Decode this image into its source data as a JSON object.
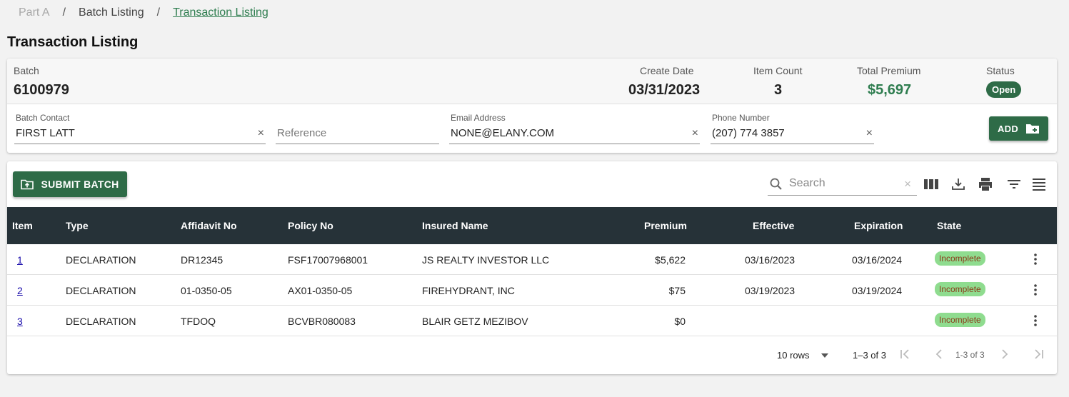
{
  "breadcrumb": {
    "part": "Part A",
    "sep": "/",
    "batch_listing": "Batch Listing",
    "current": "Transaction Listing"
  },
  "page_title": "Transaction Listing",
  "batch": {
    "batch_label": "Batch",
    "batch_value": "6100979",
    "create_date_label": "Create Date",
    "create_date_value": "03/31/2023",
    "item_count_label": "Item Count",
    "item_count_value": "3",
    "total_premium_label": "Total Premium",
    "total_premium_value": "$5,697",
    "status_label": "Status",
    "status_value": "Open"
  },
  "fields": {
    "contact_label": "Batch Contact",
    "contact_value": "FIRST LATT",
    "reference_placeholder": "Reference",
    "email_label": "Email Address",
    "email_value": "NONE@ELANY.COM",
    "phone_label": "Phone Number",
    "phone_value": "(207) 774 3857",
    "clear": "×"
  },
  "add_button": "ADD",
  "submit_button": "SUBMIT BATCH",
  "search": {
    "placeholder": "Search",
    "clear": "×"
  },
  "table": {
    "headers": {
      "item": "Item",
      "type": "Type",
      "affidavit": "Affidavit No",
      "policy": "Policy No",
      "insured": "Insured Name",
      "premium": "Premium",
      "effective": "Effective",
      "expiration": "Expiration",
      "state": "State"
    },
    "rows": [
      {
        "item": "1",
        "type": "DECLARATION",
        "affidavit": "DR12345",
        "policy": "FSF17007968001",
        "insured": "JS REALTY INVESTOR LLC",
        "premium": "$5,622",
        "effective": "03/16/2023",
        "expiration": "03/16/2024",
        "state": "Incomplete"
      },
      {
        "item": "2",
        "type": "DECLARATION",
        "affidavit": "01-0350-05",
        "policy": "AX01-0350-05",
        "insured": "FIREHYDRANT, INC",
        "premium": "$75",
        "effective": "03/19/2023",
        "expiration": "03/19/2024",
        "state": "Incomplete"
      },
      {
        "item": "3",
        "type": "DECLARATION",
        "affidavit": "TFDOQ",
        "policy": "BCVBR080083",
        "insured": "BLAIR GETZ MEZIBOV",
        "premium": "$0",
        "effective": "",
        "expiration": "",
        "state": "Incomplete"
      }
    ]
  },
  "pagination": {
    "rows_per_page": "10 rows",
    "range": "1–3 of 3",
    "range_mid": "1-3 of 3"
  },
  "icons": {
    "columns": "view-column-icon",
    "download": "download-icon",
    "print": "print-icon",
    "filter": "filter-icon",
    "density": "density-icon",
    "search": "search-icon",
    "upload": "upload-folder-icon",
    "add_folder": "add-folder-icon"
  },
  "colors": {
    "brand_green": "#2e6b47",
    "header_dark": "#263238",
    "badge_green": "#8fdc8f"
  }
}
